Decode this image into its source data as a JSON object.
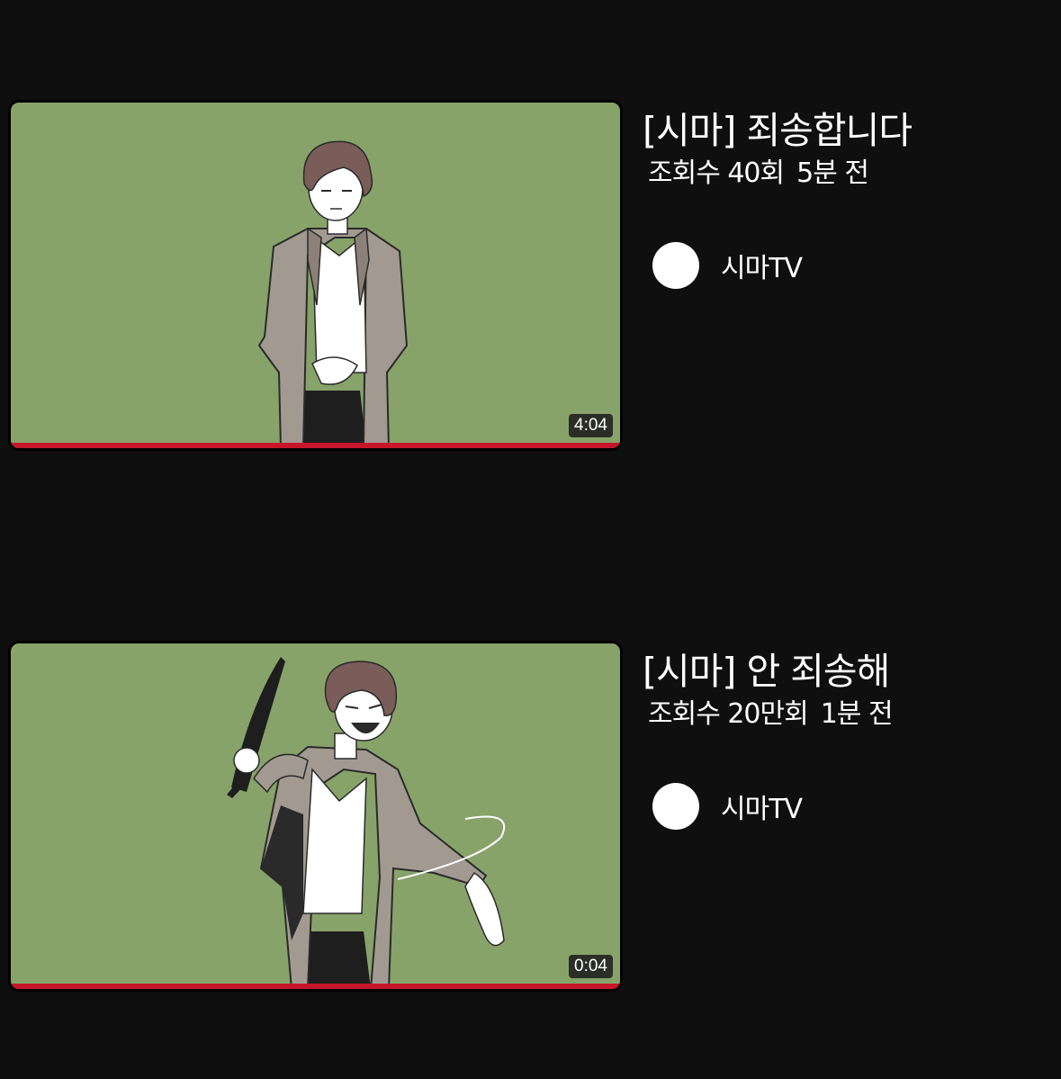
{
  "videos": [
    {
      "title": "[시마] 죄송합니다",
      "views": "조회수 40회",
      "age": "5분 전",
      "channel": "시마TV",
      "duration": "4:04",
      "progress": 1.0
    },
    {
      "title": "[시마] 안 죄송해",
      "views": "조회수 20만회",
      "age": "1분 전",
      "channel": "시마TV",
      "duration": "0:04",
      "progress": 1.0
    }
  ],
  "colors": {
    "background": "#0f0f0f",
    "thumbnail_bg": "#87a36a",
    "progress": "#c6162a",
    "text": "#ffffff"
  }
}
